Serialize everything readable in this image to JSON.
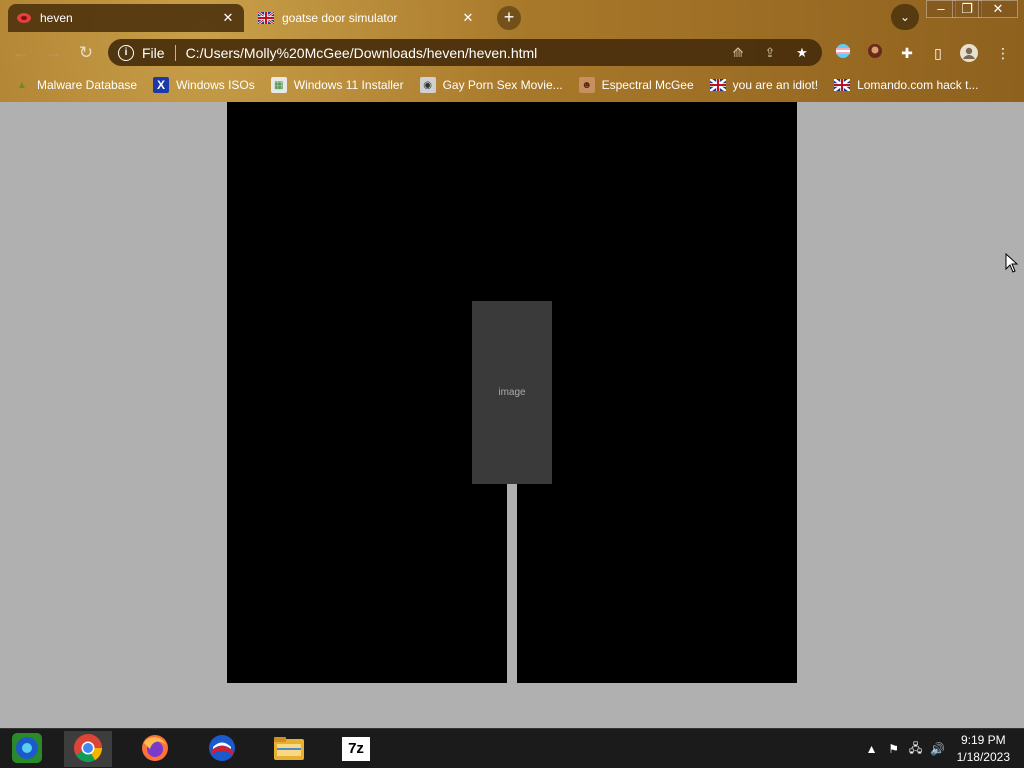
{
  "tabs": [
    {
      "title": "heven",
      "active": true,
      "favicon": "heven-favicon-icon"
    },
    {
      "title": "goatse door simulator",
      "active": false,
      "favicon": "union-jack-favicon-icon"
    }
  ],
  "newtab_label": "+",
  "window_controls": {
    "minimize": "–",
    "restore": "❐",
    "close": "✕"
  },
  "omnibox": {
    "scheme": "File",
    "url": "C:/Users/Molly%20McGee/Downloads/heven/heven.html"
  },
  "bookmarks": [
    {
      "label": "Malware Database",
      "icon": "malware-db-icon"
    },
    {
      "label": "Windows ISOs",
      "icon": "x-logo-icon"
    },
    {
      "label": "Windows 11 Installer",
      "icon": "installer-icon"
    },
    {
      "label": "Gay Porn Sex Movie...",
      "icon": "disk-icon"
    },
    {
      "label": "Espectral McGee",
      "icon": "face-icon"
    },
    {
      "label": "you are an idiot!",
      "icon": "union-jack-icon"
    },
    {
      "label": "Lomando.com hack t...",
      "icon": "union-jack-icon"
    }
  ],
  "page": {
    "background_color": "#b0b0b0",
    "door_color": "#000000",
    "image_placeholder": "image"
  },
  "taskbar": {
    "apps": [
      "start-orb-icon",
      "chrome-icon",
      "firefox-icon",
      "obama-logo-icon",
      "file-explorer-icon",
      "7zip-icon"
    ],
    "sevenzip_label": "7z",
    "time": "9:19 PM",
    "date": "1/18/2023"
  }
}
